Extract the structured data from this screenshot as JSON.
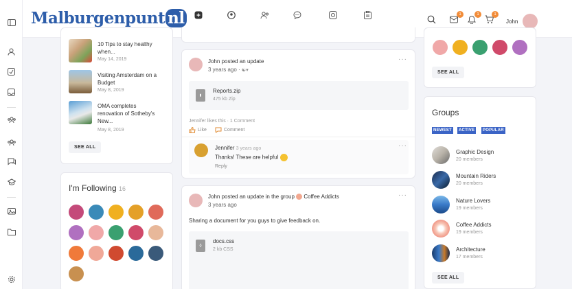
{
  "header": {
    "logo_main": "Malburgenpunt",
    "logo_suffix": "nl",
    "user_name": "John",
    "badges": {
      "messages": "1",
      "notifications": "1",
      "cart": "1"
    }
  },
  "news": {
    "items": [
      {
        "title_lines": [
          "10 Tips to stay healthy",
          "when..."
        ],
        "date": "May 14, 2019"
      },
      {
        "title_lines": [
          "Visiting Amsterdam on a",
          "Budget"
        ],
        "date": "May 8, 2019"
      },
      {
        "title_lines": [
          "OMA completes",
          "renovation of Sotheby's",
          "New..."
        ],
        "date": "May 8, 2019"
      }
    ],
    "see_all": "SEE ALL"
  },
  "following": {
    "title": "I'm Following",
    "count": "16"
  },
  "posts": [
    {
      "author": "John",
      "action": "posted an update",
      "time": "3 years ago",
      "file": {
        "name": "Reports.zip",
        "meta": "475 kb  Zip"
      },
      "likes_text": "Jennifer likes this · 1 Comment",
      "like_label": "Like",
      "comment_label": "Comment",
      "comment": {
        "author": "Jennifer",
        "time": "3 years ago",
        "text": "Thanks! These are helpful",
        "reply": "Reply"
      }
    },
    {
      "author": "John",
      "action": "posted an update in the group",
      "group": "Coffee Addicts",
      "time": "3 years ago",
      "body": "Sharing a document for you guys to give feedback on.",
      "file": {
        "name": "docs.css",
        "meta": "2 kb  CSS"
      }
    }
  ],
  "members_see_all": "SEE ALL",
  "groups": {
    "title": "Groups",
    "tabs": [
      "NEWEST",
      "ACTIVE",
      "POPULAR"
    ],
    "items": [
      {
        "name": "Graphic Design",
        "members": "20 members"
      },
      {
        "name": "Mountain Riders",
        "members": "20 members"
      },
      {
        "name": "Nature Lovers",
        "members": "19 members"
      },
      {
        "name": "Coffee Addicts",
        "members": "19 members"
      },
      {
        "name": "Architecture",
        "members": "17 members"
      }
    ],
    "see_all": "SEE ALL"
  },
  "colors": {
    "brand": "#2e5eaa",
    "accent": "#3b64c6",
    "badge": "#f28c38"
  }
}
